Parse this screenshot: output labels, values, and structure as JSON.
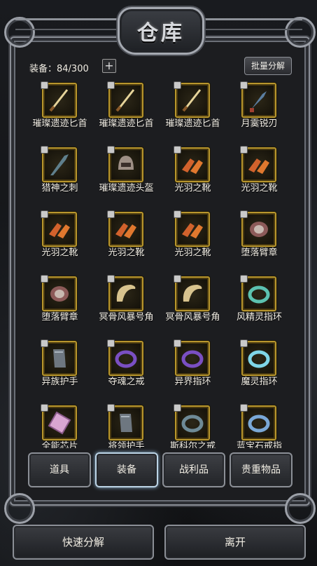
{
  "window": {
    "title": "仓库"
  },
  "header": {
    "equip_label": "装备：84/300",
    "add_symbol": "+",
    "bulk_decompose_label": "批量分解"
  },
  "items": [
    {
      "name": "璀璨遗迹匕首",
      "icon": "dagger-icon"
    },
    {
      "name": "璀璨遗迹匕首",
      "icon": "dagger-icon"
    },
    {
      "name": "璀璨遗迹匕首",
      "icon": "dagger-icon"
    },
    {
      "name": "月霙锐刃",
      "icon": "short-blade-icon"
    },
    {
      "name": "猎神之刺",
      "icon": "spike-blade-icon"
    },
    {
      "name": "璀璨遗迹头盔",
      "icon": "helmet-icon"
    },
    {
      "name": "光羽之靴",
      "icon": "boots-icon"
    },
    {
      "name": "光羽之靴",
      "icon": "boots-icon"
    },
    {
      "name": "光羽之靴",
      "icon": "boots-icon"
    },
    {
      "name": "光羽之靴",
      "icon": "boots-icon"
    },
    {
      "name": "光羽之靴",
      "icon": "boots-icon"
    },
    {
      "name": "堕落臂章",
      "icon": "armband-icon"
    },
    {
      "name": "堕落臂章",
      "icon": "armband-icon"
    },
    {
      "name": "冥骨风暴号角",
      "icon": "horn-icon"
    },
    {
      "name": "冥骨风暴号角",
      "icon": "horn-icon"
    },
    {
      "name": "风精灵指环",
      "icon": "ring-icon"
    },
    {
      "name": "异族护手",
      "icon": "gauntlet-icon"
    },
    {
      "name": "夺魂之戒",
      "icon": "ring-icon"
    },
    {
      "name": "异界指环",
      "icon": "ring-icon"
    },
    {
      "name": "魔灵指环",
      "icon": "ring-icon"
    },
    {
      "name": "全能芯片",
      "icon": "chip-icon"
    },
    {
      "name": "将领护手",
      "icon": "gauntlet-icon"
    },
    {
      "name": "斯科尔之戒",
      "icon": "ring-icon"
    },
    {
      "name": "蓝宝石戒指",
      "icon": "ring-icon"
    }
  ],
  "tabs": [
    {
      "label": "道具",
      "active": false
    },
    {
      "label": "装备",
      "active": true
    },
    {
      "label": "战利品",
      "active": false
    },
    {
      "label": "贵重物品",
      "active": false
    }
  ],
  "footer": {
    "quick_decompose_label": "快速分解",
    "leave_label": "离开"
  },
  "colors": {
    "slot_border": "#b8962d",
    "active_tab_glow": "#8fb4d1",
    "frame_metal": "#8a8e96"
  }
}
